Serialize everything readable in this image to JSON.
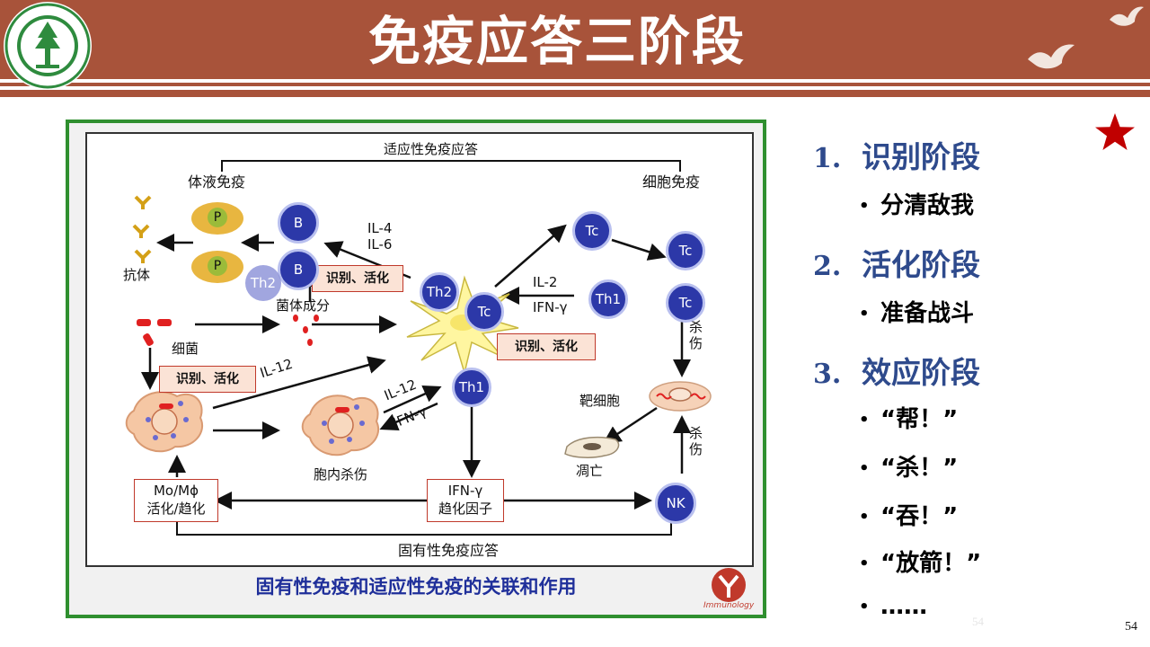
{
  "title": "免疫应答三阶段",
  "figure": {
    "adaptive_label": "适应性免疫应答",
    "humoral_label": "体液免疫",
    "cellular_label": "细胞免疫",
    "antibody_label": "抗体",
    "bacteria_label": "细菌",
    "bacteria_component_label": "菌体成分",
    "intracellular_kill_label": "胞内杀伤",
    "target_cell_label": "靶细胞",
    "apoptosis_label": "凋亡",
    "kill_label_1": "杀伤",
    "kill_label_2": "杀伤",
    "innate_label": "固有性免疫应答",
    "il4_label": "IL-4",
    "il6_label": "IL-6",
    "il2_label": "IL-2",
    "ifn_label_1": "IFN-γ",
    "il12_label_1": "IL-12",
    "il12_label_2": "IL-12",
    "ifn_label_2": "IFN-γ",
    "recog_label_1": "识别、活化",
    "recog_label_2": "识别、活化",
    "recog_label_3": "识别、活化",
    "mo_box_line1": "Mo/Mϕ",
    "mo_box_line2": "活化/趋化",
    "ifn_box_line1": "IFN-γ",
    "ifn_box_line2": "趋化因子",
    "cell_p1": "P",
    "cell_p2": "P",
    "cell_b1": "B",
    "cell_b2": "B",
    "cell_th2_faded": "Th2",
    "cell_th2": "Th2",
    "cell_tc_center": "Tc",
    "cell_th1_center": "Th1",
    "cell_th1_right": "Th1",
    "cell_tc1": "Tc",
    "cell_tc2": "Tc",
    "cell_tc3": "Tc",
    "cell_nk": "NK",
    "caption": "固有性免疫和适应性免疫的关联和作用",
    "logo_text": "Immunology"
  },
  "steps": [
    {
      "num": "1.",
      "label": "识别阶段"
    },
    {
      "num": "2.",
      "label": "活化阶段"
    },
    {
      "num": "3.",
      "label": "效应阶段"
    }
  ],
  "bullets": {
    "step1": [
      "分清敌我"
    ],
    "step2": [
      "准备战斗"
    ],
    "step3": [
      "“帮！”",
      "“杀！”",
      "“吞！”",
      "“放箭！”",
      "……"
    ],
    "dot": "•"
  },
  "page_number": "54",
  "faint_page_number": "54",
  "colors": {
    "header": "#a8533a",
    "step_text": "#2e4a8c",
    "star": "#c00000",
    "caption": "#1f2f9a",
    "figure_border": "#2f8f2f"
  }
}
